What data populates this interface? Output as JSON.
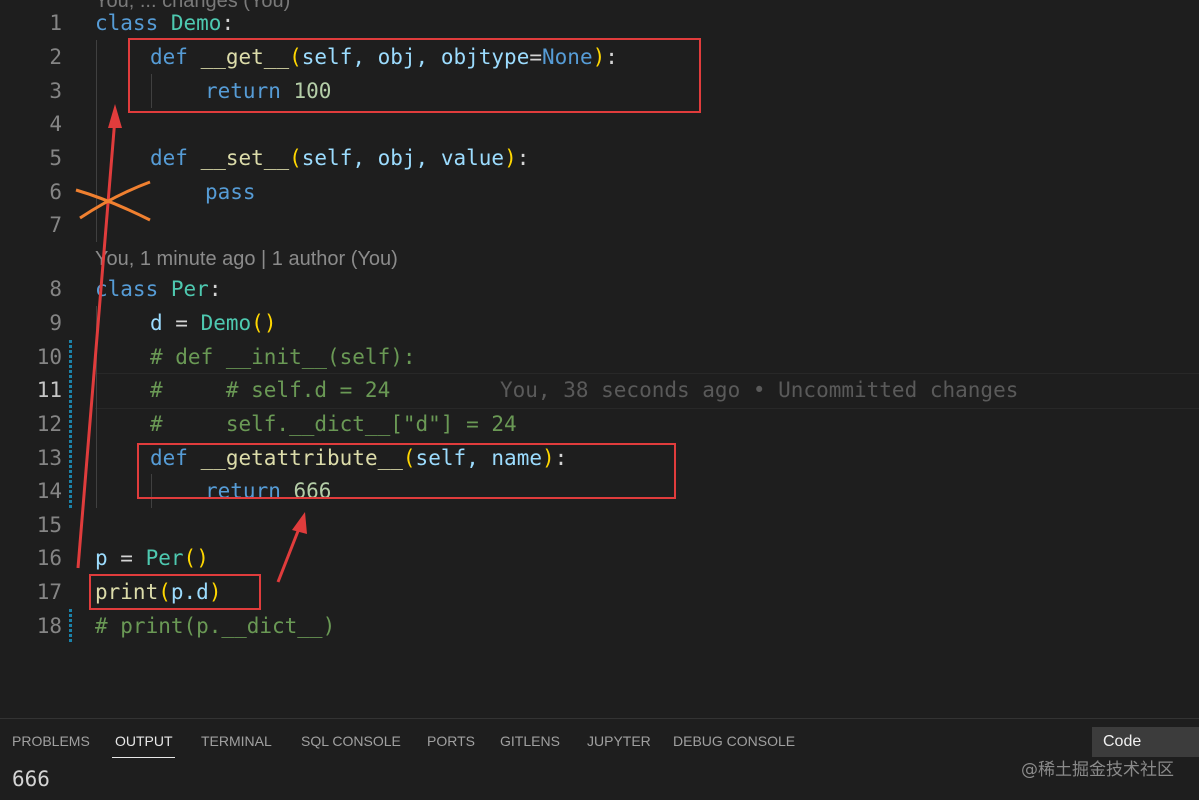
{
  "editor": {
    "top_partial": "You, ... changes (You)",
    "code_lens": "You, 1 minute ago | 1 author (You)",
    "ghost_blame": "You, 38 seconds ago • Uncommitted changes",
    "active_line": "11",
    "lines": [
      {
        "n": "1"
      },
      {
        "n": "2"
      },
      {
        "n": "3"
      },
      {
        "n": "4"
      },
      {
        "n": "5"
      },
      {
        "n": "6"
      },
      {
        "n": "7"
      },
      {
        "n": "8"
      },
      {
        "n": "9"
      },
      {
        "n": "10"
      },
      {
        "n": "11"
      },
      {
        "n": "12"
      },
      {
        "n": "13"
      },
      {
        "n": "14"
      },
      {
        "n": "15"
      },
      {
        "n": "16"
      },
      {
        "n": "17"
      },
      {
        "n": "18"
      }
    ],
    "tokens": {
      "l1": {
        "kw": "class",
        "name": "Demo",
        "colon": ":"
      },
      "l2": {
        "kw": "def",
        "name": "__get__",
        "open": "(",
        "params_a": "self, obj, ",
        "param_b": "objtype",
        "eq": "=",
        "none": "None",
        "close": ")",
        "colon": ":"
      },
      "l3": {
        "kw": "return",
        "num": "100"
      },
      "l5": {
        "kw": "def",
        "name": "__set__",
        "open": "(",
        "params": "self, obj, value",
        "close": ")",
        "colon": ":"
      },
      "l6": {
        "kw": "pass"
      },
      "l8": {
        "kw": "class",
        "name": "Per",
        "colon": ":"
      },
      "l9": {
        "var": "d",
        "eq": " = ",
        "cls": "Demo",
        "open": "(",
        "close": ")"
      },
      "l10": {
        "comment": "# def __init__(self):"
      },
      "l11": {
        "comment": "#     # self.d = 24"
      },
      "l12": {
        "comment": "#     self.__dict__[\"d\"] = 24"
      },
      "l13": {
        "kw": "def",
        "name": "__getattribute__",
        "open": "(",
        "params": "self, name",
        "close": ")",
        "colon": ":"
      },
      "l14": {
        "kw": "return",
        "num": "666"
      },
      "l16": {
        "var": "p",
        "eq": " = ",
        "cls": "Per",
        "open": "(",
        "close": ")"
      },
      "l17": {
        "fn": "print",
        "open": "(",
        "arg": "p.d",
        "close": ")"
      },
      "l18": {
        "comment": "# print(p.__dict__)"
      }
    }
  },
  "panel": {
    "tabs": [
      "PROBLEMS",
      "OUTPUT",
      "TERMINAL",
      "SQL CONSOLE",
      "PORTS",
      "GITLENS",
      "JUPYTER",
      "DEBUG CONSOLE"
    ],
    "active_tab": "OUTPUT",
    "dropdown_value": "Code",
    "output": "666"
  },
  "watermark": "@稀土掘金技术社区",
  "colors": {
    "background": "#1e1e1e",
    "keyword": "#569cd6",
    "class_name": "#4ec9b0",
    "function": "#dcdcaa",
    "comment": "#6a9955",
    "number": "#b5cea8",
    "annotation_red": "#e03c3c",
    "annotation_orange": "#f08030"
  }
}
